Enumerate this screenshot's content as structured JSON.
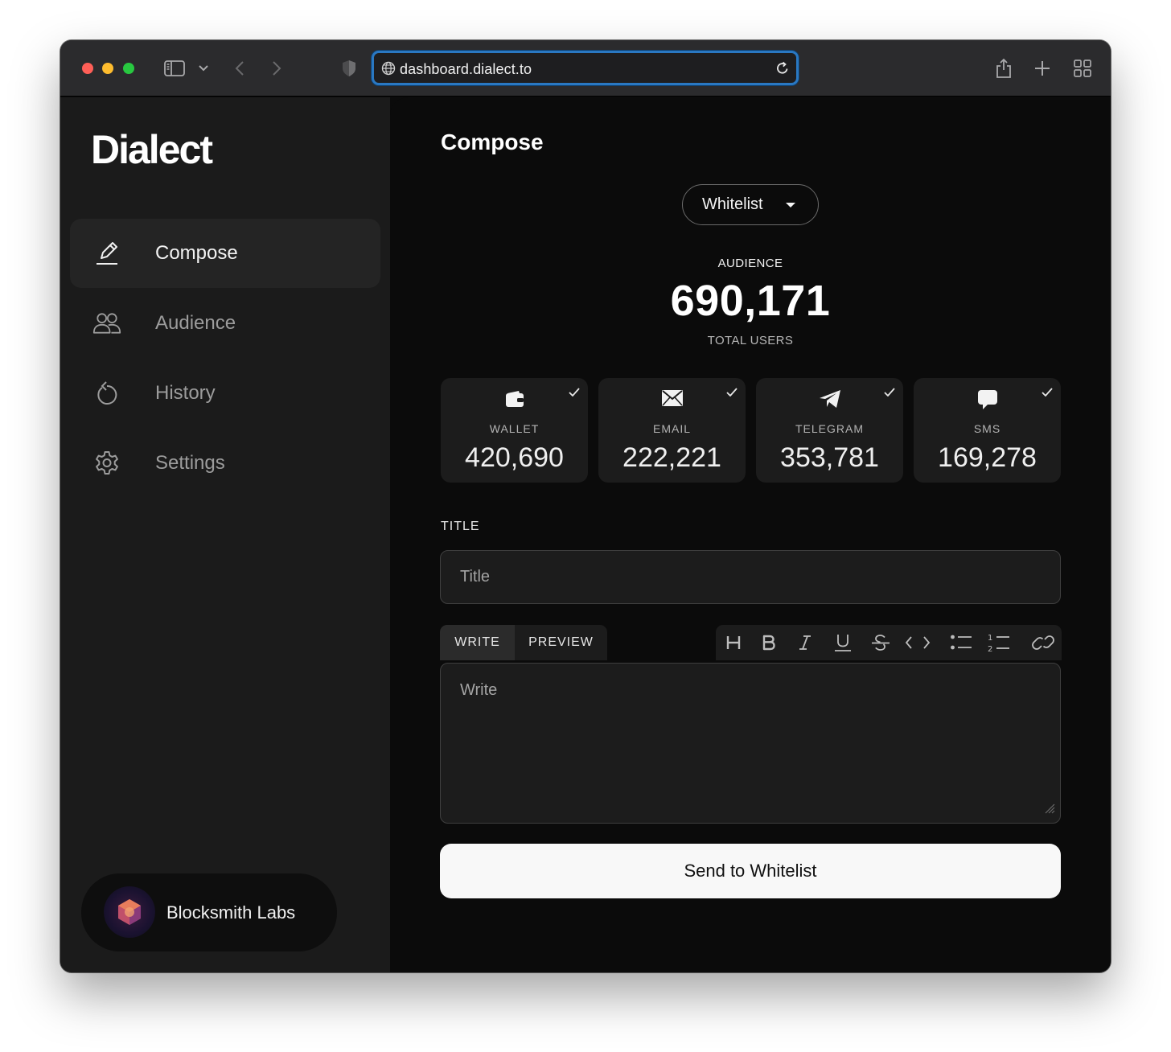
{
  "browser": {
    "url": "dashboard.dialect.to",
    "icons": [
      "sidebar-icon",
      "chevron-down-icon",
      "back-icon",
      "forward-icon",
      "shield-icon",
      "globe-icon",
      "reload-icon",
      "share-icon",
      "plus-icon",
      "tabs-grid-icon"
    ]
  },
  "sidebar": {
    "logo": "Dialect",
    "items": [
      {
        "label": "Compose",
        "icon": "pen-icon",
        "active": true
      },
      {
        "label": "Audience",
        "icon": "users-icon",
        "active": false
      },
      {
        "label": "History",
        "icon": "history-icon",
        "active": false
      },
      {
        "label": "Settings",
        "icon": "gear-icon",
        "active": false
      }
    ],
    "account": {
      "name": "Blocksmith Labs"
    }
  },
  "main": {
    "title": "Compose",
    "audience_select": "Whitelist",
    "audience": {
      "label": "AUDIENCE",
      "total": "690,171",
      "sublabel": "TOTAL USERS"
    },
    "channels": [
      {
        "label": "WALLET",
        "value": "420,690",
        "icon": "wallet-icon",
        "checked": true
      },
      {
        "label": "EMAIL",
        "value": "222,221",
        "icon": "email-icon",
        "checked": true
      },
      {
        "label": "TELEGRAM",
        "value": "353,781",
        "icon": "telegram-icon",
        "checked": true
      },
      {
        "label": "SMS",
        "value": "169,278",
        "icon": "sms-icon",
        "checked": true
      }
    ],
    "title_field": {
      "label": "TITLE",
      "placeholder": "Title",
      "value": ""
    },
    "editor": {
      "tabs": [
        "WRITE",
        "PREVIEW"
      ],
      "active_tab": "WRITE",
      "placeholder": "Write",
      "toolbar": [
        "heading-icon",
        "bold-icon",
        "italic-icon",
        "underline-icon",
        "strikethrough-icon",
        "code-icon",
        "bullet-list-icon",
        "numbered-list-icon",
        "link-icon"
      ]
    },
    "send_button": "Send to Whitelist"
  },
  "colors": {
    "sidebar_bg": "#1b1b1b",
    "main_bg": "#0b0b0b",
    "card_bg": "#1c1c1c",
    "url_focus": "#2a78c2",
    "button_bg": "#f8f8f8"
  }
}
